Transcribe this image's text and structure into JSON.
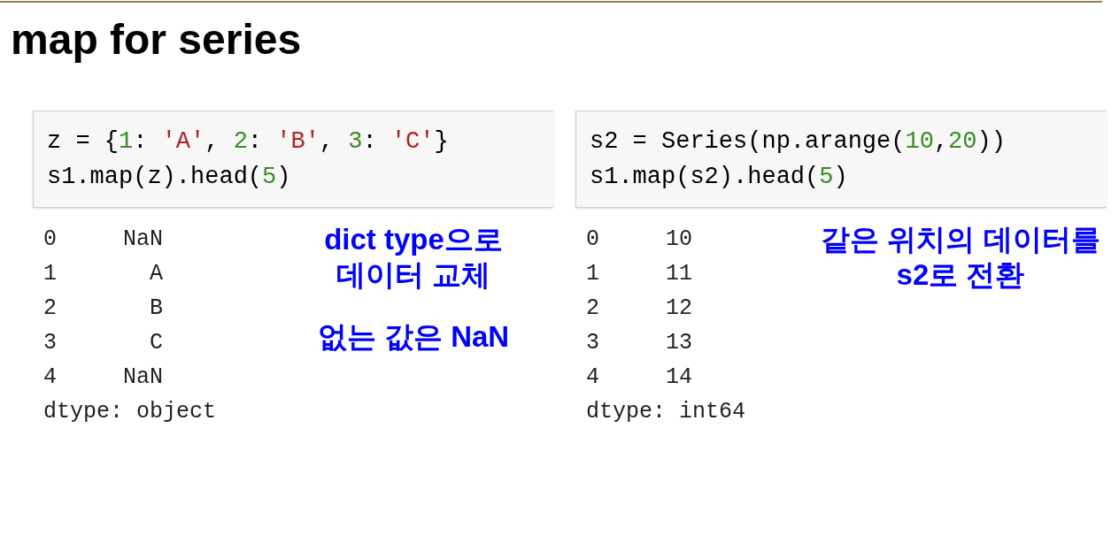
{
  "title": "map for series",
  "cells": [
    {
      "code": [
        [
          {
            "kind": "plain",
            "text": "z = {"
          },
          {
            "kind": "num",
            "text": "1"
          },
          {
            "kind": "plain",
            "text": ": "
          },
          {
            "kind": "str",
            "text": "'A'"
          },
          {
            "kind": "plain",
            "text": ", "
          },
          {
            "kind": "num",
            "text": "2"
          },
          {
            "kind": "plain",
            "text": ": "
          },
          {
            "kind": "str",
            "text": "'B'"
          },
          {
            "kind": "plain",
            "text": ", "
          },
          {
            "kind": "num",
            "text": "3"
          },
          {
            "kind": "plain",
            "text": ": "
          },
          {
            "kind": "str",
            "text": "'C'"
          },
          {
            "kind": "plain",
            "text": "}"
          }
        ],
        [
          {
            "kind": "plain",
            "text": "s1.map(z).head("
          },
          {
            "kind": "num",
            "text": "5"
          },
          {
            "kind": "plain",
            "text": ")"
          }
        ]
      ],
      "output": [
        "0     NaN",
        "1       A",
        "2       B",
        "3       C",
        "4     NaN",
        "dtype: object"
      ],
      "notes": [
        "dict type으로\n데이터 교체",
        "없는 값은 NaN"
      ]
    },
    {
      "code": [
        [
          {
            "kind": "plain",
            "text": "s2 = Series(np.arange("
          },
          {
            "kind": "num",
            "text": "10"
          },
          {
            "kind": "plain",
            "text": ","
          },
          {
            "kind": "num",
            "text": "20"
          },
          {
            "kind": "plain",
            "text": "))"
          }
        ],
        [
          {
            "kind": "plain",
            "text": "s1.map(s2).head("
          },
          {
            "kind": "num",
            "text": "5"
          },
          {
            "kind": "plain",
            "text": ")"
          }
        ]
      ],
      "output": [
        "0     10",
        "1     11",
        "2     12",
        "3     13",
        "4     14",
        "dtype: int64"
      ],
      "notes": [
        "같은 위치의 데이터를\ns2로 전환"
      ]
    }
  ]
}
